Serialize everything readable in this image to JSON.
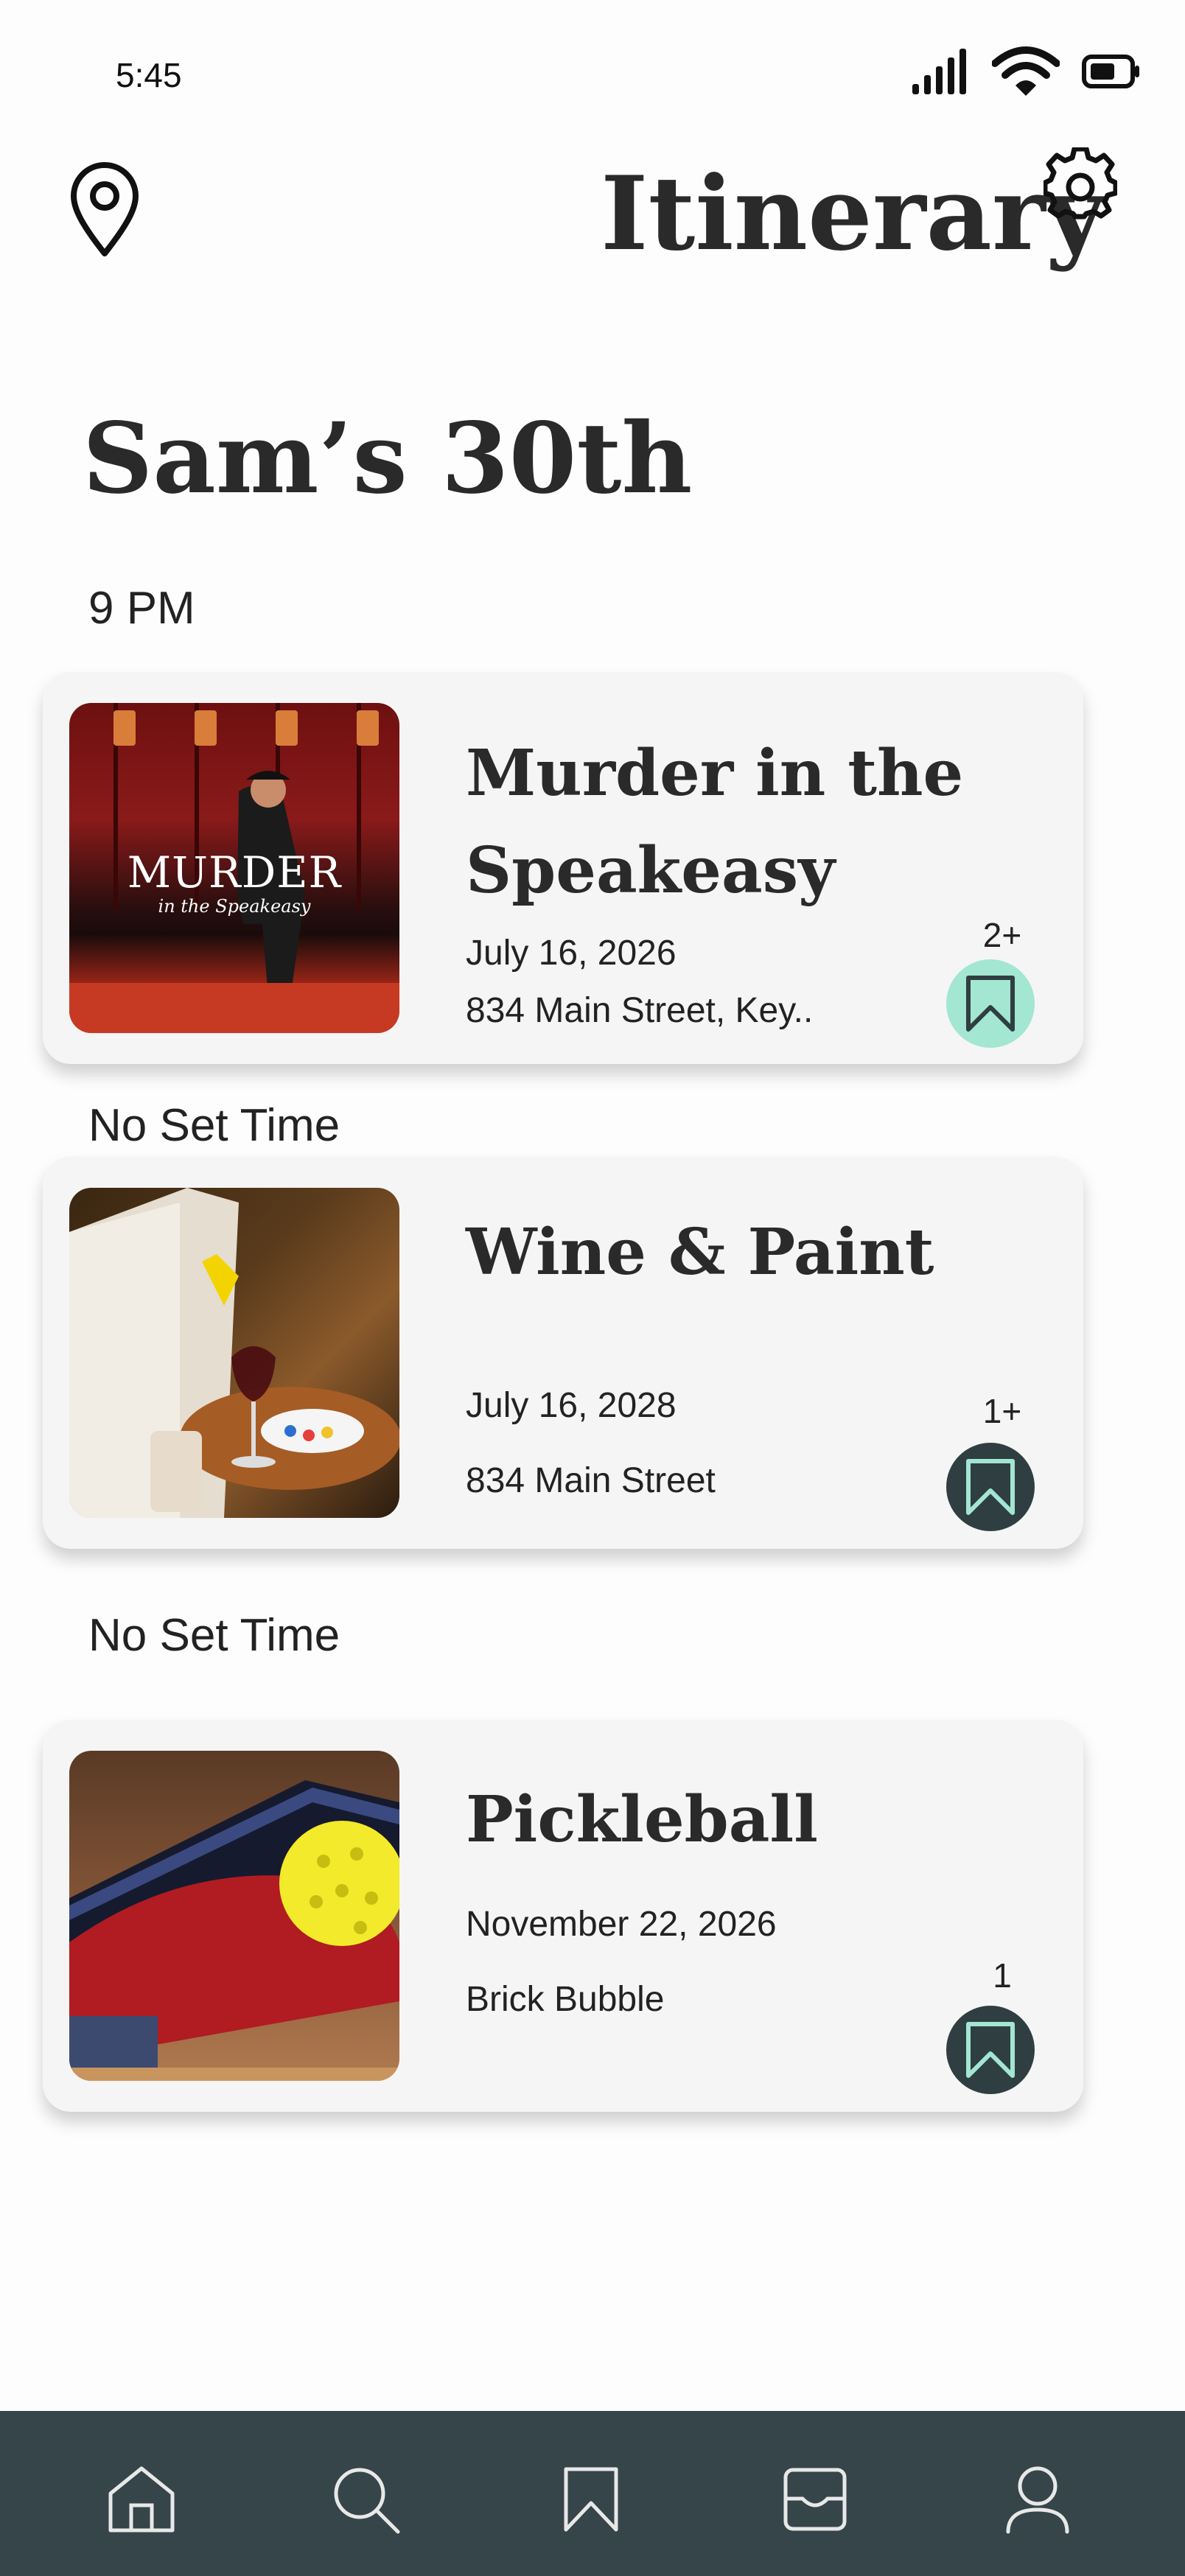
{
  "status_bar": {
    "time": "5:45"
  },
  "header": {
    "title": "Itinerary"
  },
  "event": {
    "name": "Sam’s 30th"
  },
  "schedule": [
    {
      "time_label": "9 PM",
      "title_line1": "Murder in the",
      "title_line2": "Speakeasy",
      "date": "July 16,  2026",
      "location": "834 Main Street, Key..",
      "count": "2+",
      "thumb_caption_main": "MURDER",
      "thumb_caption_sub": "in the Speakeasy",
      "bookmark_color": "#a3e6d1"
    },
    {
      "time_label": "No Set Time",
      "title": "Wine & Paint",
      "date": "July 16,  2028",
      "location": "834 Main Street",
      "count": "1+",
      "bookmark_color": "#2f3e41"
    },
    {
      "time_label": "No Set Time",
      "title": "Pickleball",
      "date": "November 22, 2026",
      "location": "Brick Bubble",
      "count": "1",
      "bookmark_color": "#2f3e41"
    }
  ],
  "nav": {
    "items": [
      "home-icon",
      "search-icon",
      "bookmark-icon",
      "inbox-icon",
      "profile-icon"
    ],
    "background": "#36454a"
  }
}
